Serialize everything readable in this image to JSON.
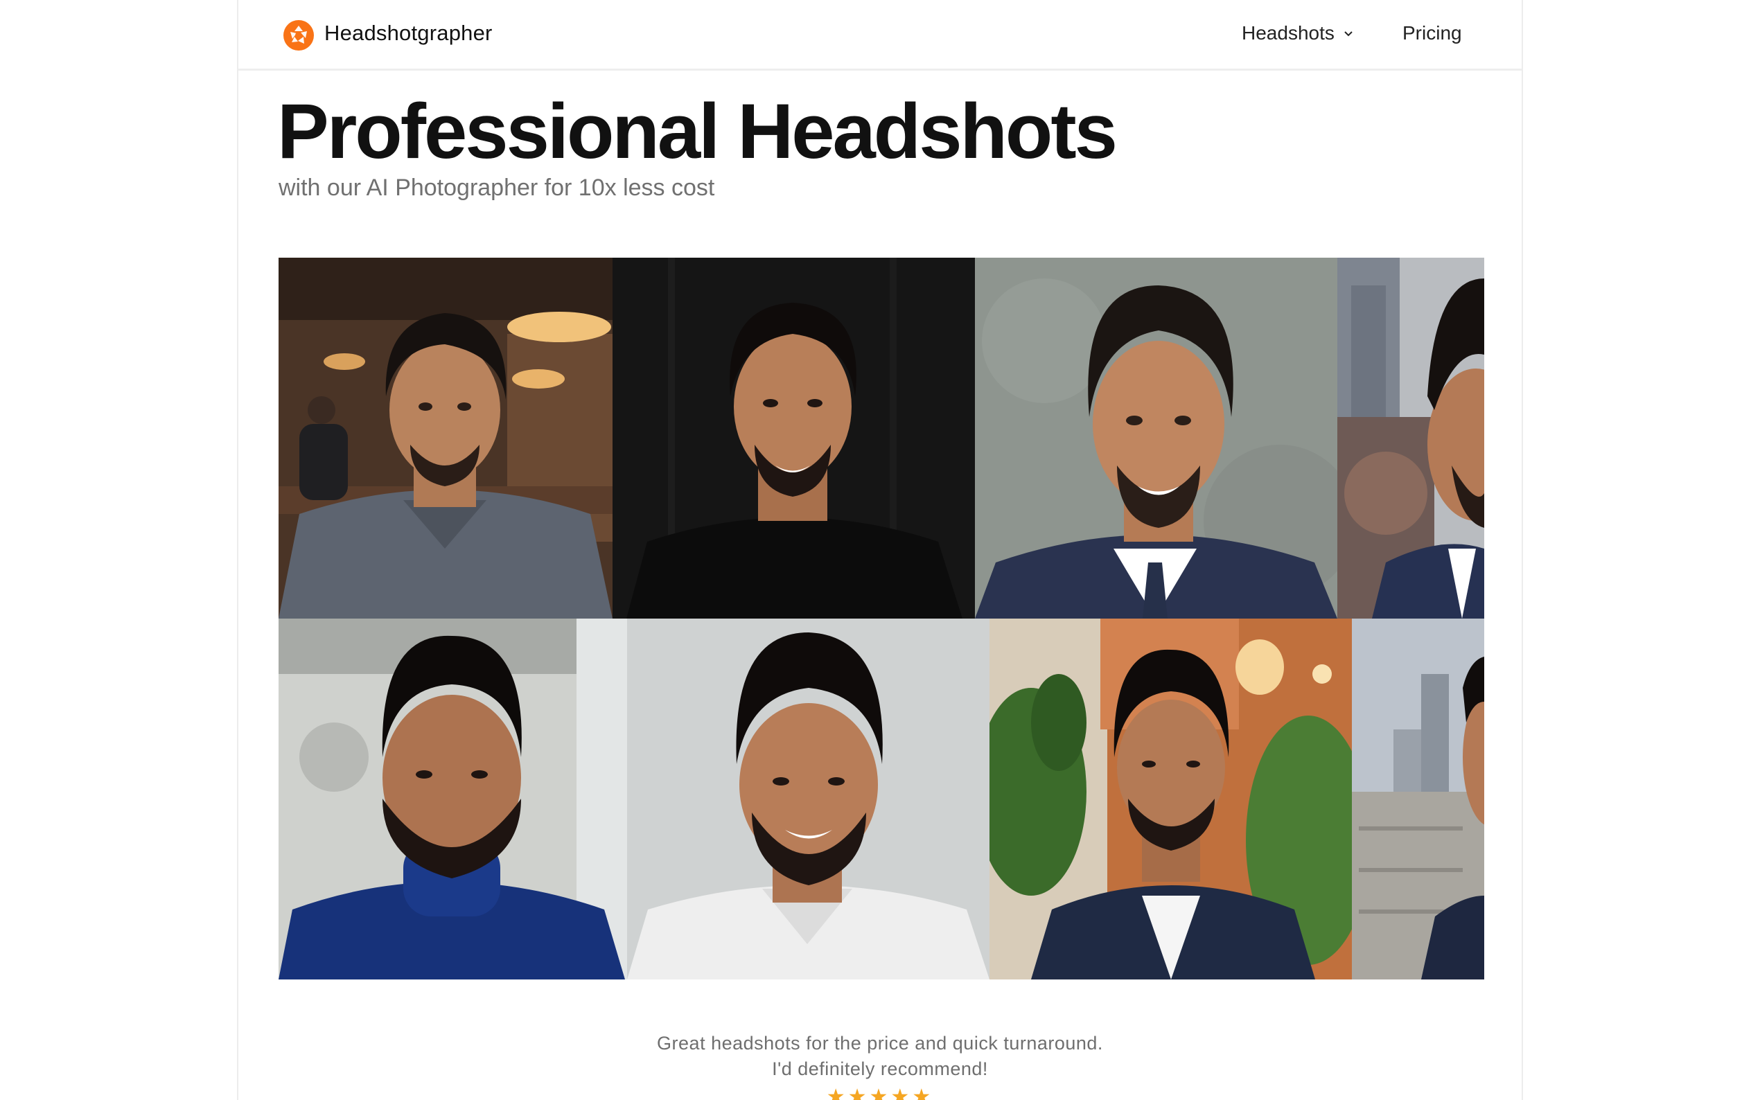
{
  "brand": {
    "name": "Headshotgrapher",
    "logo_icon": "aperture-icon",
    "accent": "#f97316"
  },
  "nav": {
    "headshots_label": "Headshots",
    "pricing_label": "Pricing"
  },
  "hero": {
    "title": "Professional Headshots",
    "subtitle": "with our AI Photographer for 10x less cost"
  },
  "gallery": {
    "photos": [
      {
        "row": 1,
        "bg": "cafe",
        "outfit": "gray-shirt"
      },
      {
        "row": 1,
        "bg": "black",
        "outfit": "black-shirt"
      },
      {
        "row": 1,
        "bg": "gray-texture",
        "outfit": "navy-suit"
      },
      {
        "row": 1,
        "bg": "city",
        "outfit": "navy-suit"
      },
      {
        "row": 2,
        "bg": "gray-wall",
        "outfit": "blue-turtleneck"
      },
      {
        "row": 2,
        "bg": "light-gray",
        "outfit": "white-shirt"
      },
      {
        "row": 2,
        "bg": "plants",
        "outfit": "navy-suit"
      },
      {
        "row": 2,
        "bg": "city",
        "outfit": "navy-suit"
      }
    ]
  },
  "testimonial": {
    "line1": "Great headshots for the price and quick turnaround.",
    "line2": "I'd definitely recommend!",
    "stars": "★★★★★",
    "rating": 5,
    "star_color": "#f5a623"
  }
}
